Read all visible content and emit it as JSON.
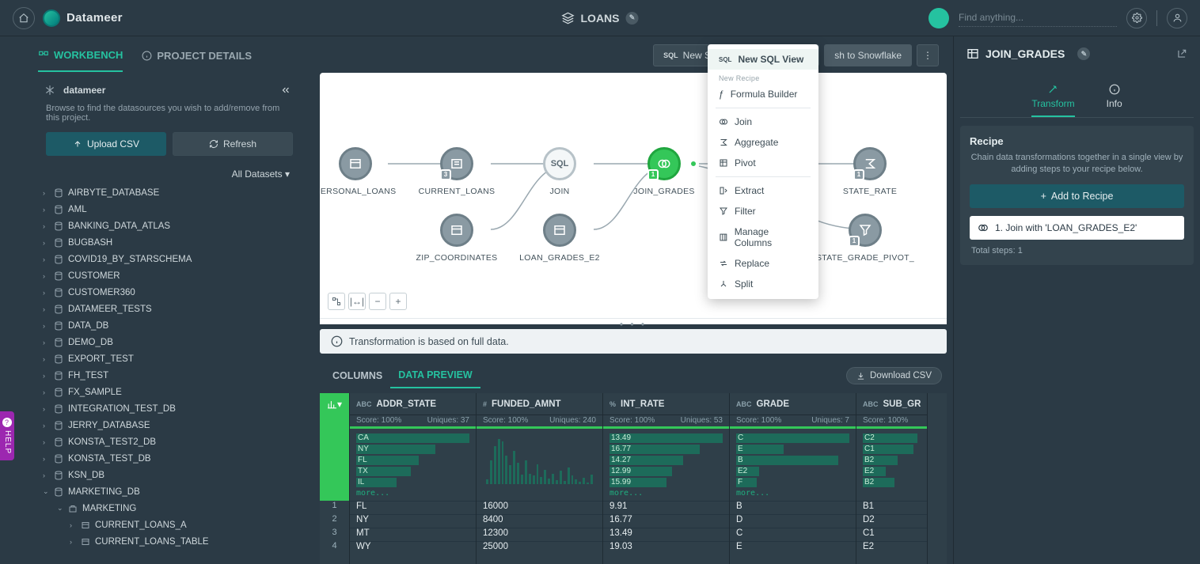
{
  "brand": "Datameer",
  "project": "LOANS",
  "search_placeholder": "Find anything...",
  "tabs": {
    "workbench": "WORKBENCH",
    "details": "PROJECT DETAILS"
  },
  "datasource": {
    "name": "datameer",
    "hint": "Browse to find the datasources you wish to add/remove from this project.",
    "upload": "Upload CSV",
    "refresh": "Refresh",
    "filter": "All Datasets"
  },
  "tree": [
    "AIRBYTE_DATABASE",
    "AML",
    "BANKING_DATA_ATLAS",
    "BUGBASH",
    "COVID19_BY_STARSCHEMA",
    "CUSTOMER",
    "CUSTOMER360",
    "DATAMEER_TESTS",
    "DATA_DB",
    "DEMO_DB",
    "EXPORT_TEST",
    "FH_TEST",
    "FX_SAMPLE",
    "INTEGRATION_TEST_DB",
    "JERRY_DATABASE",
    "KONSTA_TEST2_DB",
    "KONSTA_TEST_DB",
    "KSN_DB",
    "MARKETING_DB"
  ],
  "tree_expanded": {
    "schema": "MARKETING",
    "tables": [
      "CURRENT_LOANS_A",
      "CURRENT_LOANS_TABLE"
    ]
  },
  "toolbar": {
    "new_sql_editor": "New SQL Editor",
    "new": "New",
    "publish": "sh to Snowflake"
  },
  "dropdown": {
    "new_sql_view": "New SQL View",
    "group": "New Recipe",
    "items": [
      "Formula Builder",
      "Join",
      "Aggregate",
      "Pivot",
      "Extract",
      "Filter",
      "Manage Columns",
      "Replace",
      "Split"
    ]
  },
  "nodes": {
    "personal_loans": "PERSONAL_LOANS",
    "current_loans": "CURRENT_LOANS",
    "join": "JOIN",
    "join_grades": "JOIN_GRADES",
    "state_rate": "STATE_RATE",
    "zip": "ZIP_COORDINATES",
    "loan_grades": "LOAN_GRADES_E2",
    "state_pivot": "STATE_GRADE_PIVOT_",
    "sql": "SQL"
  },
  "info_strip": "Transformation is based on full data.",
  "pv": {
    "columns": "COLUMNS",
    "data_preview": "DATA PREVIEW",
    "download": "Download CSV"
  },
  "columns": [
    {
      "type": "ABC",
      "name": "ADDR_STATE",
      "score": "Score: 100%",
      "uniques": "Uniques: 37",
      "bars": [
        [
          "CA",
          100
        ],
        [
          "NY",
          70
        ],
        [
          "FL",
          55
        ],
        [
          "TX",
          48
        ],
        [
          "IL",
          36
        ]
      ],
      "more": "more...",
      "cells": [
        "FL",
        "NY",
        "MT",
        "WY"
      ]
    },
    {
      "type": "#",
      "name": "FUNDED_AMNT",
      "score": "Score: 100%",
      "uniques": "Uniques: 240",
      "hist": [
        10,
        50,
        80,
        95,
        90,
        60,
        40,
        70,
        45,
        20,
        50,
        22,
        18,
        42,
        15,
        30,
        12,
        22,
        8,
        28,
        6,
        35,
        18,
        10,
        5,
        14,
        4,
        20
      ],
      "cells": [
        "16000",
        "8400",
        "12300",
        "25000"
      ]
    },
    {
      "type": "%",
      "name": "INT_RATE",
      "score": "Score: 100%",
      "uniques": "Uniques: 53",
      "bars": [
        [
          "13.49",
          100
        ],
        [
          "16.77",
          80
        ],
        [
          "14.27",
          65
        ],
        [
          "12.99",
          55
        ],
        [
          "15.99",
          50
        ]
      ],
      "more": "more...",
      "cells": [
        "9.91",
        "16.77",
        "13.49",
        "19.03"
      ]
    },
    {
      "type": "ABC",
      "name": "GRADE",
      "score": "Score: 100%",
      "uniques": "Uniques: 7",
      "bars": [
        [
          "C",
          100
        ],
        [
          "E",
          42
        ],
        [
          "B",
          90
        ],
        [
          "E2",
          20
        ],
        [
          "F",
          18
        ]
      ],
      "more": "more...",
      "cells": [
        "B",
        "D",
        "C",
        "E"
      ]
    },
    {
      "type": "ABC",
      "name": "SUB_GR",
      "score": "Score: 100%",
      "uniques": "",
      "bars": [
        [
          "C2",
          95
        ],
        [
          "C1",
          88
        ],
        [
          "B2",
          60
        ],
        [
          "E2",
          40
        ],
        [
          "B2",
          55
        ]
      ],
      "more": "",
      "cells": [
        "B1",
        "D2",
        "C1",
        "E2"
      ]
    }
  ],
  "right": {
    "title": "JOIN_GRADES",
    "tabs": {
      "transform": "Transform",
      "info": "Info"
    },
    "recipe_h": "Recipe",
    "recipe_desc": "Chain data transformations together in a single view by adding steps to your recipe below.",
    "add": "Add to Recipe",
    "step": "1. Join with 'LOAN_GRADES_E2'",
    "total_label": "Total steps: ",
    "total_count": "1"
  },
  "help": "HELP"
}
